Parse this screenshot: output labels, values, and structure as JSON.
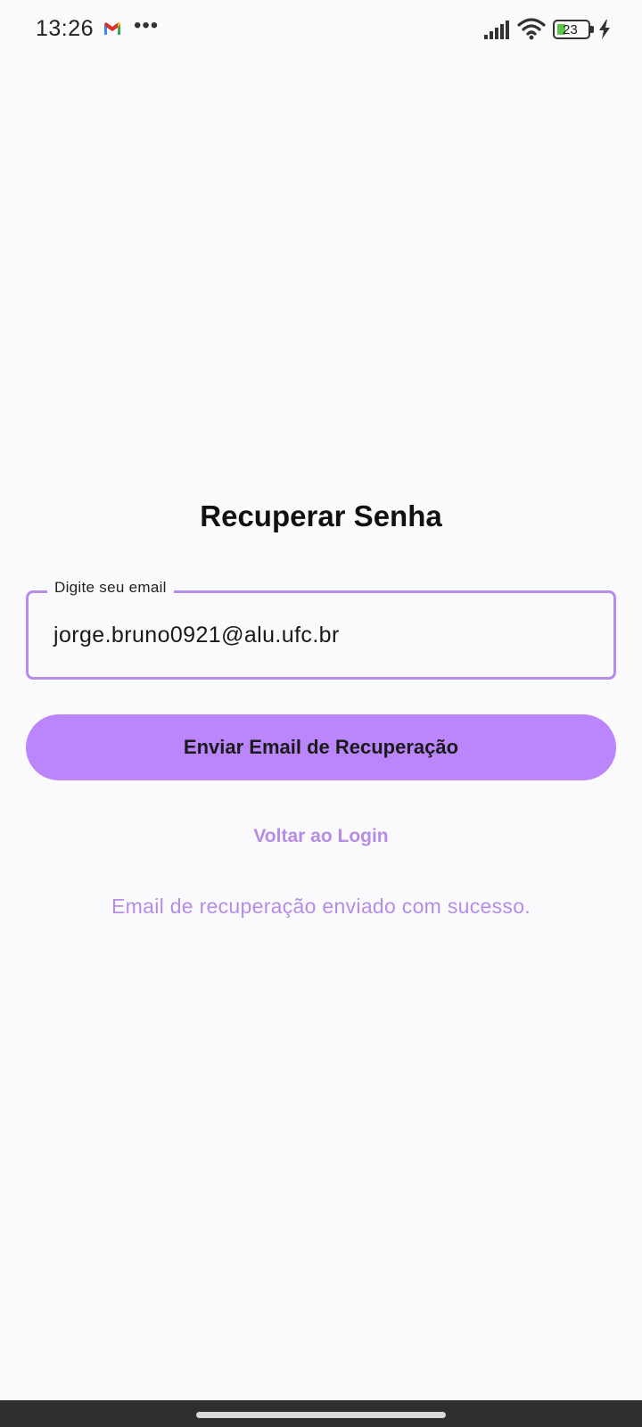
{
  "status_bar": {
    "time": "13:26",
    "battery_level": "23",
    "icons": [
      "gmail-icon",
      "more-dots-icon",
      "signal-icon",
      "wifi-icon",
      "battery-icon",
      "charging-icon"
    ]
  },
  "page": {
    "title": "Recuperar Senha"
  },
  "email_field": {
    "label": "Digite seu email",
    "value": "jorge.bruno0921@alu.ufc.br"
  },
  "actions": {
    "send_label": "Enviar Email de Recuperação",
    "back_label": "Voltar ao Login"
  },
  "message": {
    "success": "Email de recuperação enviado com sucesso."
  },
  "colors": {
    "accent": "#bb86fc",
    "accent_text": "#b58de6",
    "background": "#faf9fb"
  }
}
